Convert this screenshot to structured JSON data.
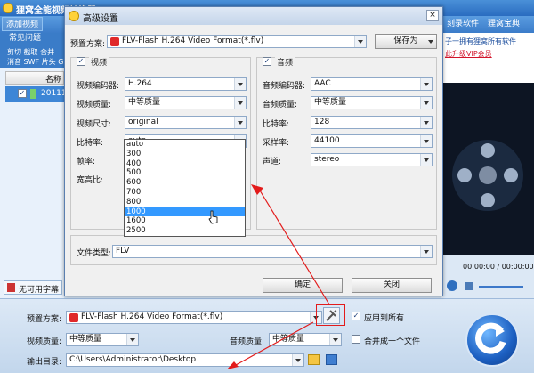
{
  "app": {
    "title": "狸窝全能视频转换器",
    "toolbar": {
      "add_video": "添加视频",
      "software": "刻录软件",
      "treasury": "狸窝宝典"
    },
    "left_panel": {
      "tab": "常见问题",
      "line1": "剪切 截取 合并",
      "line2": "消音 SWF 片头 G"
    },
    "list": {
      "header": "名称",
      "row": "20111"
    },
    "right_promo": {
      "line1": "子一拥有狸窝所有软件",
      "line2": "此升级VIP会员"
    },
    "player": {
      "time": "00:00:00 / 00:00:00"
    },
    "no_subtitle": "无可用字幕"
  },
  "bottom": {
    "preset_label": "预置方案:",
    "preset_value": "FLV-Flash H.264 Video Format(*.flv)",
    "apply_all": "应用到所有",
    "video_quality_label": "视频质量:",
    "video_quality_value": "中等质量",
    "audio_quality_label": "音频质量:",
    "audio_quality_value": "中等质量",
    "merge_label": "合并成一个文件",
    "output_label": "输出目录:",
    "output_value": "C:\\Users\\Administrator\\Desktop"
  },
  "dialog": {
    "title": "高级设置",
    "close": "×",
    "preset_label": "预置方案:",
    "preset_value": "FLV-Flash H.264 Video Format(*.flv)",
    "save_as": "保存为",
    "video": {
      "title": "视频",
      "encoder_label": "视频编码器:",
      "encoder_value": "H.264",
      "quality_label": "视频质量:",
      "quality_value": "中等质量",
      "size_label": "视频尺寸:",
      "size_value": "original",
      "bitrate_label": "比特率:",
      "bitrate_value": "auto",
      "framerate_label": "帧率:",
      "aspect_label": "宽高比:"
    },
    "audio": {
      "title": "音频",
      "encoder_label": "音频编码器:",
      "encoder_value": "AAC",
      "quality_label": "音频质量:",
      "quality_value": "中等质量",
      "bitrate_label": "比特率:",
      "bitrate_value": "128",
      "samplerate_label": "采样率:",
      "samplerate_value": "44100",
      "channel_label": "声道:",
      "channel_value": "stereo"
    },
    "filetype_label": "文件类型:",
    "filetype_value": "FLV",
    "ok": "确定",
    "close_btn": "关闭"
  },
  "dropdown": {
    "options": [
      "auto",
      "300",
      "400",
      "500",
      "600",
      "700",
      "800",
      "1000",
      "1600",
      "2500"
    ],
    "selected": "1000"
  },
  "colors": {
    "title_bar": "#2a6cc0",
    "selection": "#3399ff",
    "annotation": "#e31b1b"
  }
}
